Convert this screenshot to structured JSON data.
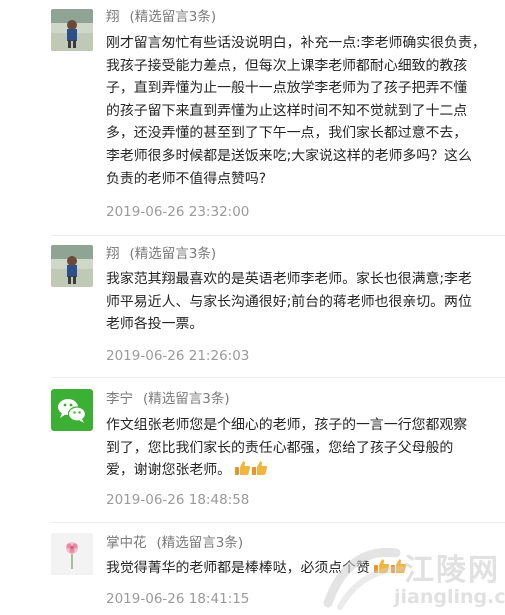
{
  "comments": [
    {
      "name": "翔",
      "tag": "(精选留言3条)",
      "lines": [
        "刚才留言匆忙有些话没说明白，补充一点:李老师确实很负责，",
        "我孩子接受能力差点，但每次上课李老师都耐心细致的教孩",
        "子，直到弄懂为止一般十一点放学李老师为了孩子把弄不懂",
        "的孩子留下来直到弄懂为止这样时间不知不觉就到了十二点",
        "多，还没弄懂的甚至到了下午一点，我们家长都过意不去，",
        "李老师很多时候都是送饭来吃;大家说这样的老师多吗？这么",
        "负责的老师不值得点赞吗?"
      ],
      "time": "2019-06-26 23:32:00",
      "avatar": "child-photo-avatar"
    },
    {
      "name": "翔",
      "tag": "(精选留言3条)",
      "lines": [
        "我家范其翔最喜欢的是英语老师李老师。家长也很满意;李老",
        "师平易近人、与家长沟通很好;前台的蒋老师也很亲切。两位",
        "老师各投一票。"
      ],
      "time": "2019-06-26 21:26:03",
      "avatar": "child-photo-avatar"
    },
    {
      "name": "李宁",
      "tag": "(精选留言3条)",
      "lines": [
        "作文组张老师您是个细心的老师，孩子的一言一行您都观察",
        "到了，您比我们家长的责任心都强，您给了孩子父母般的",
        "爱，谢谢您张老师。"
      ],
      "thumbs_after_last": true,
      "time": "2019-06-26 18:48:58",
      "avatar": "wechat-logo-avatar"
    },
    {
      "name": "掌中花",
      "tag": "(精选留言3条)",
      "lines": [
        "我觉得菁华的老师都是棒棒哒，必须点个赞"
      ],
      "thumbs_after_last": true,
      "time": "2019-06-26 18:41:15",
      "avatar": "flower-avatar"
    }
  ],
  "watermark": {
    "text": "江陵网",
    "url": "jiangling.cn"
  },
  "colors": {
    "name": "#7b7b7b",
    "body": "#262626",
    "time": "#9b9b9b",
    "wechat_green": "#3cb034",
    "thumb": "#f1b43c"
  }
}
